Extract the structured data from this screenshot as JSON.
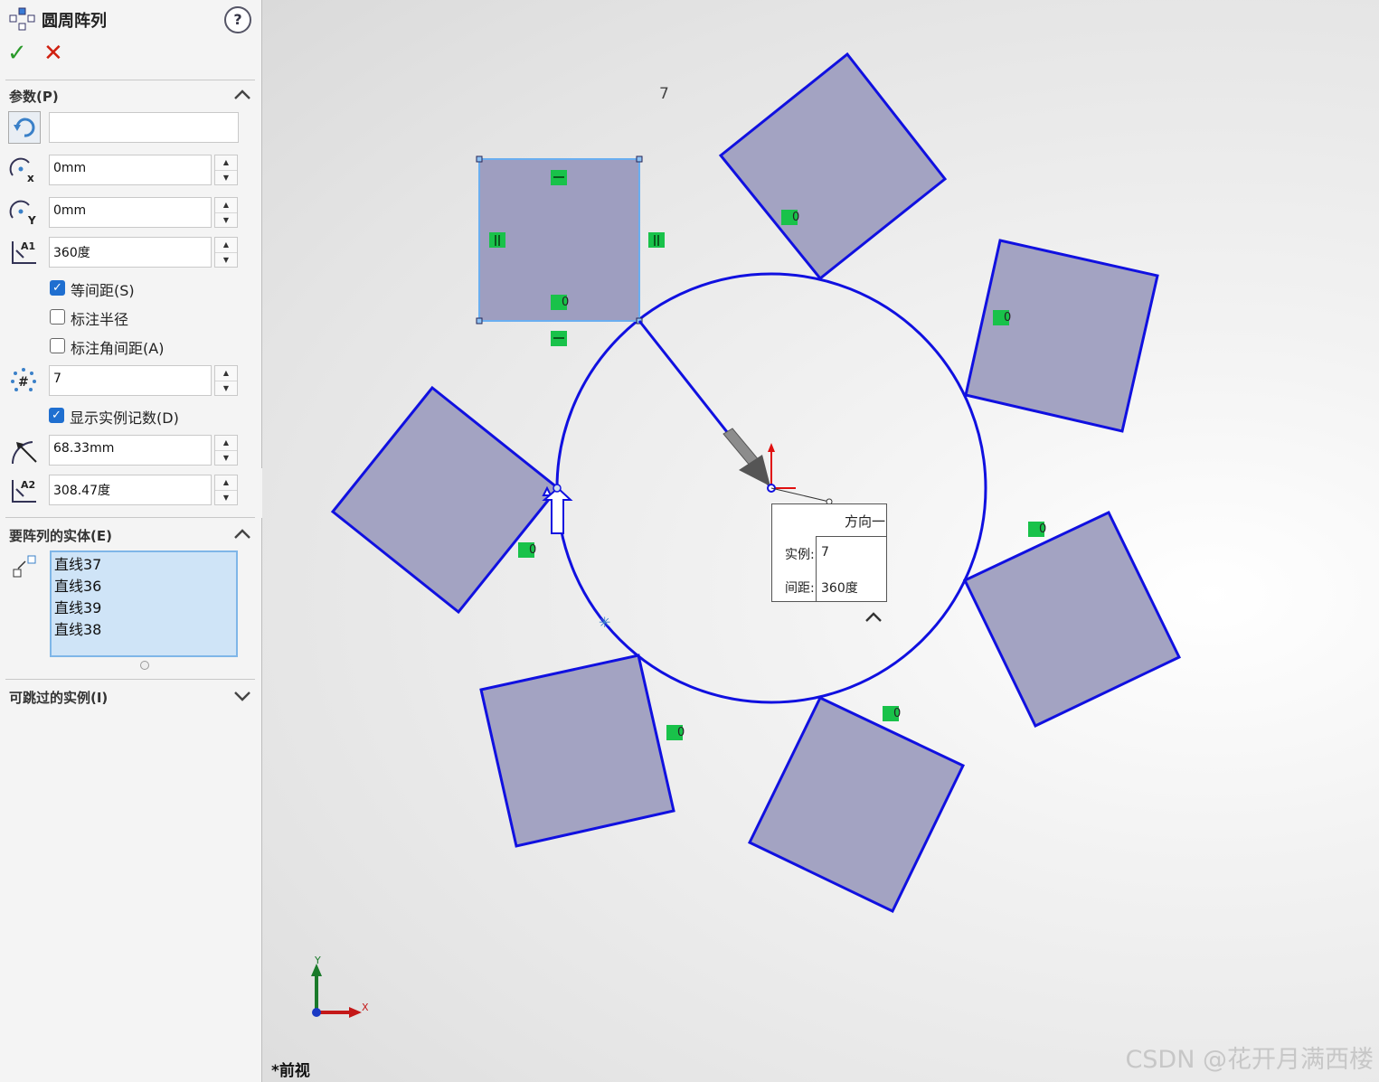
{
  "panel": {
    "title": "圆周阵列",
    "help_icon": "?",
    "ok_icon": "✓",
    "cancel_icon": "✕",
    "params": {
      "header": "参数(P)",
      "center_value": "",
      "x_value": "0mm",
      "y_value": "0mm",
      "angle_value": "360度",
      "equal_spacing_label": "等间距(S)",
      "equal_spacing_checked": true,
      "dim_radius_label": "标注半径",
      "dim_radius_checked": false,
      "dim_angle_label": "标注角间距(A)",
      "dim_angle_checked": false,
      "count_value": "7",
      "show_count_label": "显示实例记数(D)",
      "show_count_checked": true,
      "radius_value": "68.33mm",
      "rotation_value": "308.47度"
    },
    "entities": {
      "header": "要阵列的实体(E)",
      "items": [
        "直线37",
        "直线36",
        "直线39",
        "直线38"
      ]
    },
    "skip": {
      "header": "可跳过的实例(I)"
    }
  },
  "viewport": {
    "count_label": "7",
    "callout": {
      "direction": "方向一",
      "instances_label": "实例:",
      "instances_value": "7",
      "spacing_label": "间距:",
      "spacing_value": "360度"
    },
    "relation_label": "0",
    "axis_x": "X",
    "axis_y": "Y",
    "view_name": "*前视",
    "watermark": "CSDN @花开月满西楼"
  },
  "colors": {
    "sketch_line": "#1010e0",
    "square_fill": "#9e9ec0",
    "selected_outline": "#6aaef0",
    "relation_green": "#19c24a",
    "listbox": "#cfe4f7"
  }
}
